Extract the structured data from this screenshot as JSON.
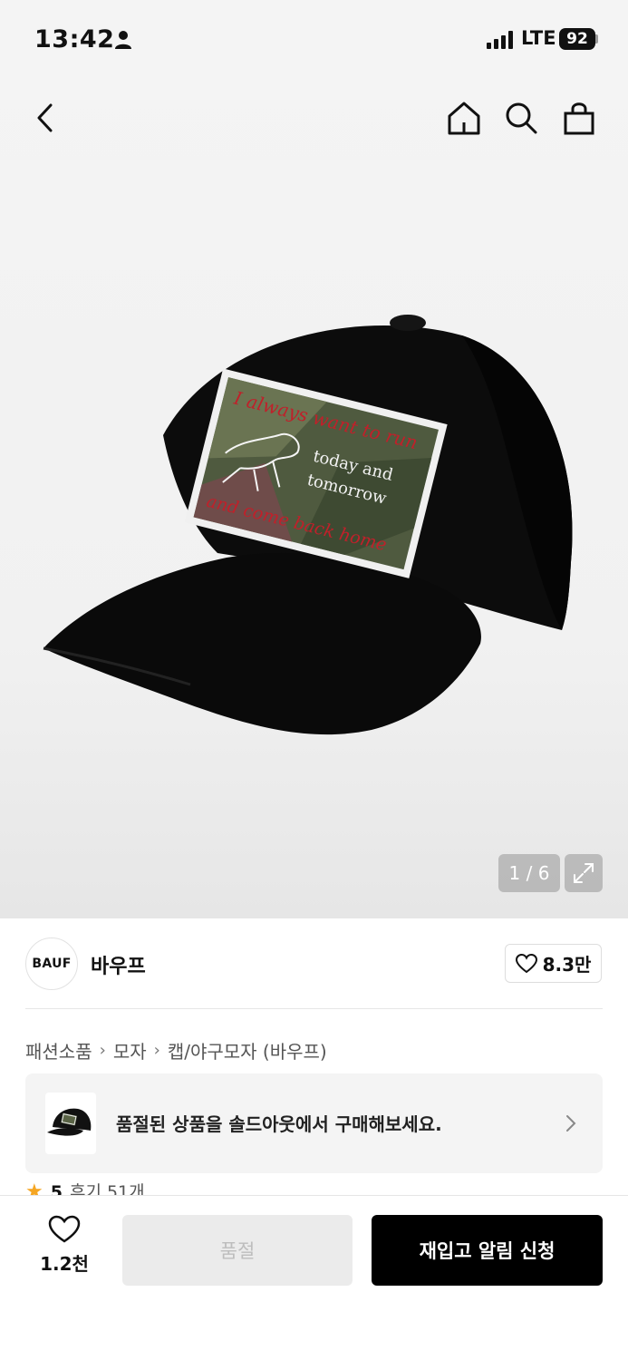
{
  "status_bar": {
    "time": "13:42",
    "network": "LTE",
    "battery": "92"
  },
  "product_image": {
    "counter": "1 / 6",
    "patch_text": {
      "line1": "I always want to run",
      "line2": "today and",
      "line3": "tomorrow",
      "line4": "and come back home"
    }
  },
  "brand": {
    "logo_text": "BAUF",
    "name": "바우프",
    "likes": "8.3만"
  },
  "breadcrumb": [
    "패션소품",
    "모자",
    "캡/야구모자 (바우프)"
  ],
  "soldout_notice": {
    "text": "품절된 상품을 솔드아웃에서 구매해보세요."
  },
  "rating": {
    "score": "5",
    "reviews": "후기 51개"
  },
  "bottom_bar": {
    "wish_count": "1.2천",
    "soldout_label": "품절",
    "restock_label": "재입고 알림 신청"
  },
  "colors": {
    "primary": "#000000",
    "disabled_bg": "#ebebeb",
    "star": "#f5a623"
  },
  "icons": [
    "person-icon",
    "signal-icon",
    "back-icon",
    "home-icon",
    "search-icon",
    "cart-icon",
    "expand-icon",
    "heart-icon",
    "chevron-right-icon",
    "star-icon"
  ]
}
